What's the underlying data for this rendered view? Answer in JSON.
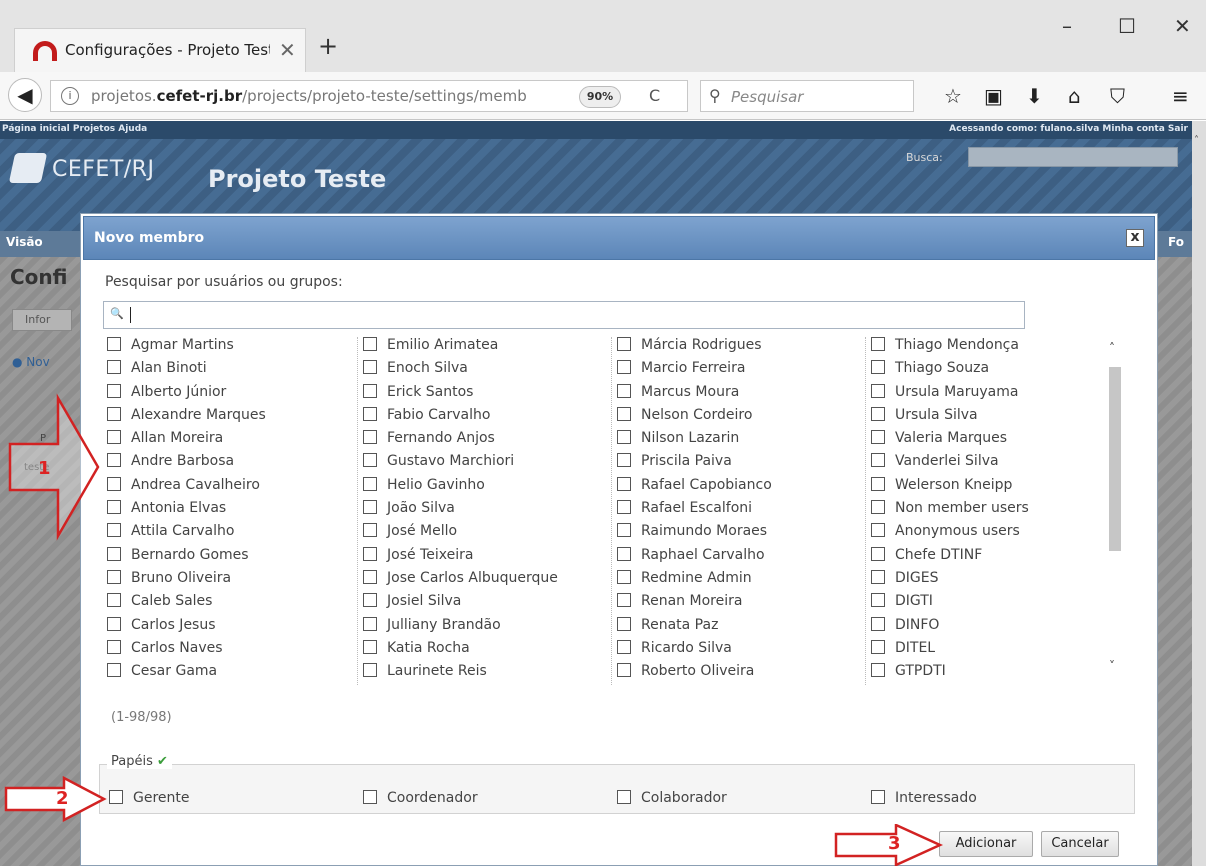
{
  "browser": {
    "tab_title": "Configurações - Projeto Teste",
    "tab_close": "✕",
    "new_tab": "+",
    "win_minimize": "–",
    "win_maximize": "☐",
    "win_close": "✕",
    "back": "◀",
    "info": "i",
    "url_prefix": "projetos.",
    "url_domain": "cefet-rj.br",
    "url_path": "/projects/projeto-teste/settings/memb",
    "zoom": "90%",
    "reload": "C",
    "search_placeholder": "Pesquisar",
    "search_glass": "⚲",
    "toolbar_icons": [
      "☆",
      "▣",
      "⬇",
      "⌂",
      "⛉",
      "≡"
    ]
  },
  "page": {
    "topmenu_left": "Página inicial  Projetos  Ajuda",
    "topmenu_right": "Acessando como: fulano.silva   Minha conta   Sair",
    "logo_text": "CEFET/RJ",
    "project_title": "Projeto Teste",
    "busca_label": "Busca:",
    "menu_left": "Visão",
    "menu_right": "Fo",
    "conf_title": "Confi",
    "tab_fragment": "Infor",
    "novo_fragment": "● Nov",
    "frag_1": "P",
    "frag_2": "teste"
  },
  "modal": {
    "title": "Novo membro",
    "close": "x",
    "search_label": "Pesquisar por usuários ou grupos:",
    "search_icon": "🔍",
    "users": [
      [
        "Agmar Martins",
        "Alan Binoti",
        "Alberto Júnior",
        "Alexandre Marques",
        "Allan Moreira",
        "Andre Barbosa",
        "Andrea Cavalheiro",
        "Antonia Elvas",
        "Attila Carvalho",
        "Bernardo Gomes",
        "Bruno Oliveira",
        "Caleb Sales",
        "Carlos Jesus",
        "Carlos Naves",
        "Cesar Gama"
      ],
      [
        "Emilio Arimatea",
        "Enoch Silva",
        "Erick Santos",
        "Fabio Carvalho",
        "Fernando Anjos",
        "Gustavo Marchiori",
        "Helio Gavinho",
        "João Silva",
        "José Mello",
        "José Teixeira",
        "Jose Carlos Albuquerque",
        "Josiel Silva",
        "Julliany Brandão",
        "Katia Rocha",
        "Laurinete Reis"
      ],
      [
        "Márcia Rodrigues",
        "Marcio Ferreira",
        "Marcus Moura",
        "Nelson Cordeiro",
        "Nilson Lazarin",
        "Priscila Paiva",
        "Rafael Capobianco",
        "Rafael Escalfoni",
        "Raimundo Moraes",
        "Raphael Carvalho",
        "Redmine Admin",
        "Renan Moreira",
        "Renata Paz",
        "Ricardo Silva",
        "Roberto Oliveira"
      ],
      [
        "Thiago Mendonça",
        "Thiago Souza",
        "Ursula Maruyama",
        "Ursula Silva",
        "Valeria Marques",
        "Vanderlei Silva",
        "Welerson Kneipp",
        "Non member users",
        "Anonymous users",
        "Chefe DTINF",
        "DIGES",
        "DIGTI",
        "DINFO",
        "DITEL",
        "GTPDTI"
      ]
    ],
    "scroll_up": "˄",
    "scroll_down": "˅",
    "pagination": "(1-98/98)",
    "papeis_label": "Papéis",
    "papeis_check": "✔",
    "roles": [
      "Gerente",
      "Coordenador",
      "Colaborador",
      "Interessado"
    ],
    "add_button": "Adicionar",
    "cancel_button": "Cancelar"
  },
  "annotations": {
    "arrow_1": "1",
    "arrow_2": "2",
    "arrow_3": "3",
    "color": "#d22222"
  }
}
